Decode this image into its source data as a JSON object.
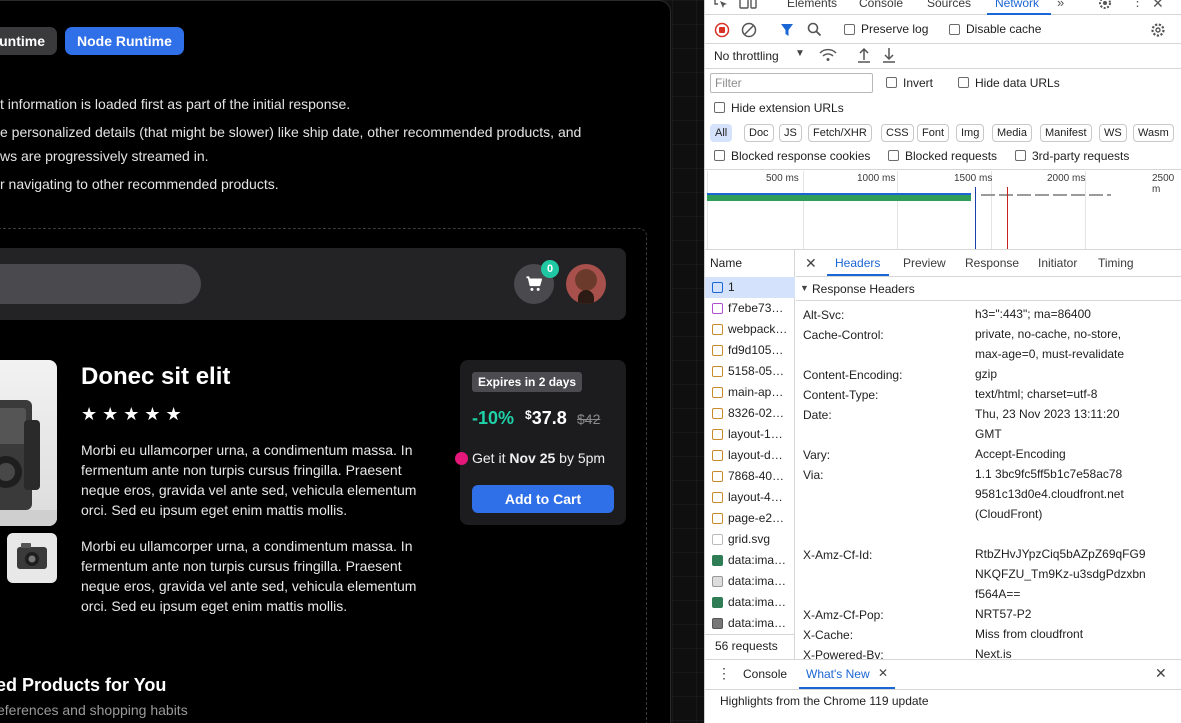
{
  "runtime_buttons": {
    "edge": "untime",
    "node": "Node Runtime"
  },
  "bullets": [
    "t information is loaded first as part of the initial response.",
    "e personalized details (that might be slower) like ship date, other recommended products, and",
    "ws are progressively streamed in.",
    "r navigating to other recommended products."
  ],
  "cart": {
    "count": "0"
  },
  "product": {
    "title": "Donec sit elit",
    "rating": 5,
    "stars": "★★★★★",
    "description_1": "Morbi eu ullamcorper urna, a condimentum massa. In fermentum ante non turpis cursus fringilla. Praesent neque eros, gravida vel ante sed, vehicula elementum orci. Sed eu ipsum eget enim mattis mollis.",
    "description_2": "Morbi eu ullamcorper urna, a condimentum massa. In fermentum ante non turpis cursus fringilla. Praesent neque eros, gravida vel ante sed, vehicula elementum orci. Sed eu ipsum eget enim mattis mollis."
  },
  "pricing": {
    "expires": "Expires in 2 days",
    "discount": "-10%",
    "currency": "$",
    "price": "37.8",
    "old_price": "$42",
    "delivery_prefix": "Get it ",
    "delivery_date": "Nov 25",
    "delivery_suffix": " by 5pm",
    "add_to_cart": "Add to Cart"
  },
  "recommended": {
    "title": "ed Products for You",
    "subtitle": "eferences and shopping habits"
  },
  "devtools": {
    "tabs": [
      "Elements",
      "Console",
      "Sources",
      "Network"
    ],
    "preserve_log": "Preserve log",
    "disable_cache": "Disable cache",
    "throttling": "No throttling",
    "filter_placeholder": "Filter",
    "invert": "Invert",
    "hide_data_urls": "Hide data URLs",
    "hide_extension_urls": "Hide extension URLs",
    "chips": [
      "All",
      "Doc",
      "JS",
      "Fetch/XHR",
      "CSS",
      "Font",
      "Img",
      "Media",
      "Manifest",
      "WS",
      "Wasm"
    ],
    "blocked_cookies": "Blocked response cookies",
    "blocked_requests": "Blocked requests",
    "third_party": "3rd-party requests",
    "timeline_ticks": [
      "500 ms",
      "1000 ms",
      "1500 ms",
      "2000 ms",
      "2500 m"
    ],
    "name_header": "Name",
    "requests": [
      "1",
      "f7ebe73…",
      "webpack…",
      "fd9d105…",
      "5158-05…",
      "main-ap…",
      "8326-02…",
      "layout-1…",
      "layout-d…",
      "7868-40…",
      "layout-4…",
      "page-e2…",
      "grid.svg",
      "data:ima…",
      "data:ima…",
      "data:ima…",
      "data:ima…"
    ],
    "request_count": "56 requests",
    "detail_tabs": [
      "Headers",
      "Preview",
      "Response",
      "Initiator",
      "Timing"
    ],
    "section": "Response Headers",
    "headers": [
      {
        "key": "Alt-Svc:",
        "value": "h3=\":443\"; ma=86400"
      },
      {
        "key": "Cache-Control:",
        "value": "private, no-cache, no-store, max-age=0, must-revalidate"
      },
      {
        "key": "Content-Encoding:",
        "value": "gzip"
      },
      {
        "key": "Content-Type:",
        "value": "text/html; charset=utf-8"
      },
      {
        "key": "Date:",
        "value": "Thu, 23 Nov 2023 13:11:20 GMT"
      },
      {
        "key": "Vary:",
        "value": "Accept-Encoding"
      },
      {
        "key": "Via:",
        "value": "1.1 3bc9fc5ff5b1c7e58ac789581c13d0e4.cloudfront.net (CloudFront)"
      },
      {
        "key": "X-Amz-Cf-Id:",
        "value": "RtbZHvJYpzCiq5bAZpZ69qFG9NKQFZU_Tm9Kz-u3sdgPdzxbnf564A=="
      },
      {
        "key": "X-Amz-Cf-Pop:",
        "value": "NRT57-P2"
      },
      {
        "key": "X-Cache:",
        "value": "Miss from cloudfront"
      },
      {
        "key": "X-Powered-By:",
        "value": "Next.is"
      }
    ],
    "drawer_tabs": [
      "Console",
      "What's New"
    ],
    "drawer_message": "Highlights from the Chrome 119 update"
  }
}
